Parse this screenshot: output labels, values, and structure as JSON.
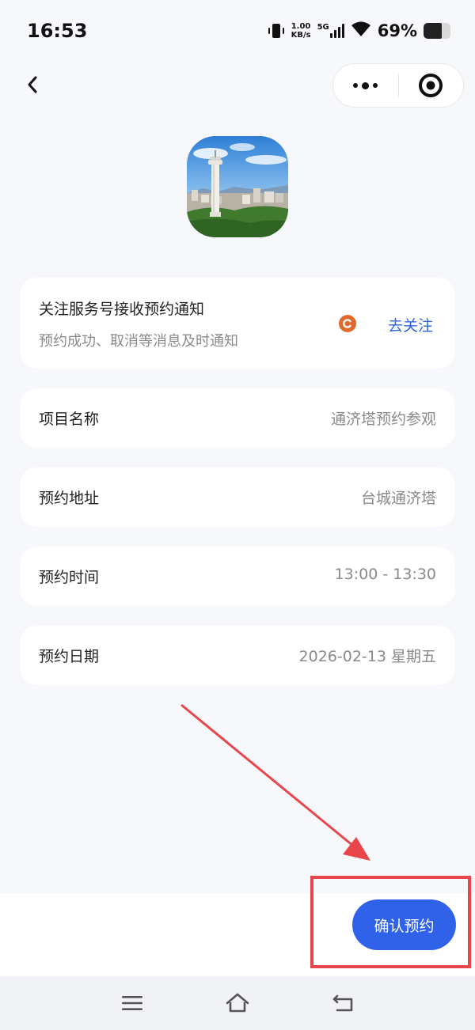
{
  "status_bar": {
    "time": "16:53",
    "net_speed_value": "1.00",
    "net_speed_unit": "KB/s",
    "network_type": "5G",
    "battery_percent": "69%",
    "battery_level": 0.69
  },
  "notify_card": {
    "title": "关注服务号接收预约通知",
    "subtitle": "预约成功、取消等消息及时通知",
    "follow_label": "去关注"
  },
  "details": [
    {
      "label": "项目名称",
      "value": "通济塔预约参观"
    },
    {
      "label": "预约地址",
      "value": "台城通济塔"
    },
    {
      "label": "预约时间",
      "value": "13:00 - 13:30"
    },
    {
      "label": "预约日期",
      "value": "2026-02-13 星期五"
    }
  ],
  "confirm_button": {
    "label": "确认预约"
  },
  "colors": {
    "accent": "#2f62e8",
    "link": "#2d63e0",
    "annotation": "#e8464a",
    "follow_icon": "#e06a2c"
  },
  "icons": [
    "back-icon",
    "more-icon",
    "close-miniprogram-icon",
    "follow-icon",
    "menu-icon",
    "home-icon",
    "return-icon"
  ]
}
